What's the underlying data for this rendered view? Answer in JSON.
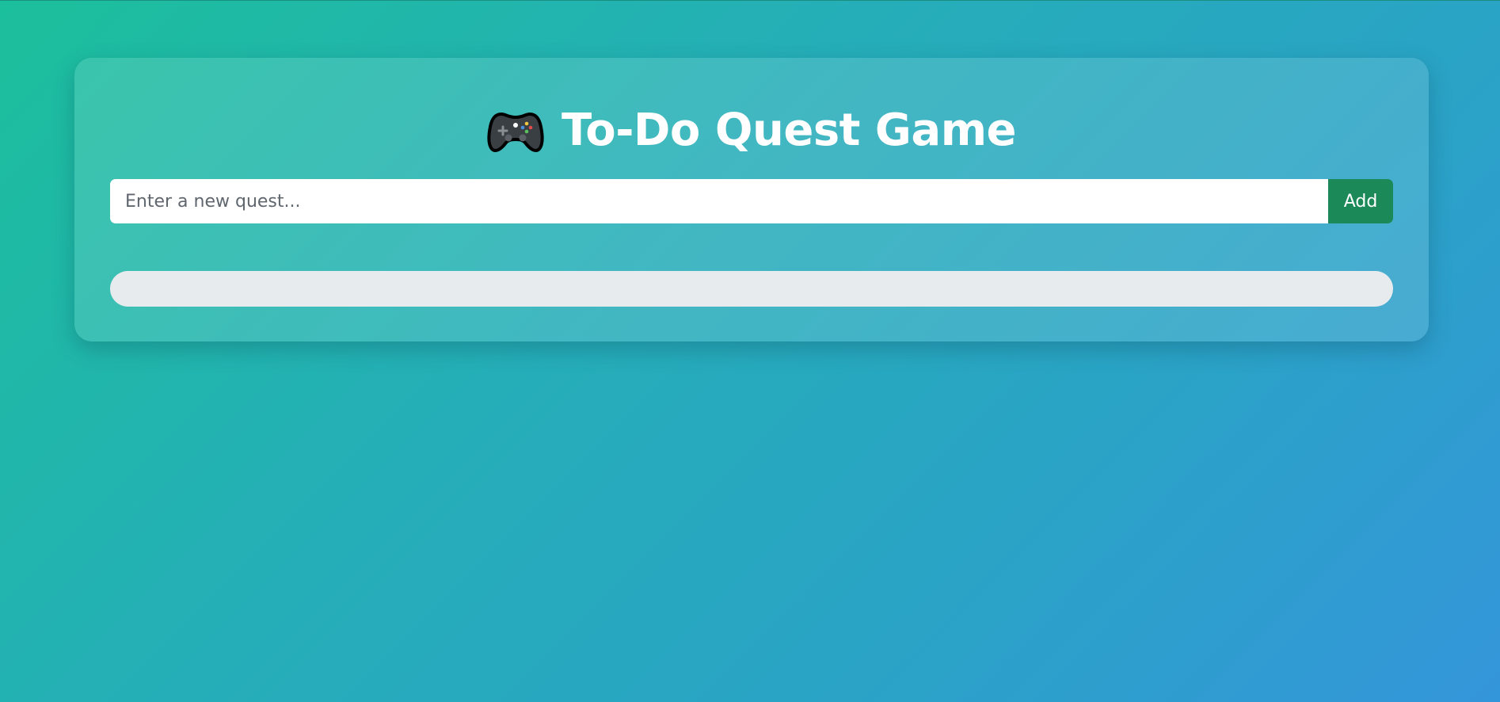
{
  "app": {
    "title": "To-Do Quest Game",
    "title_icon": "game-controller-icon"
  },
  "quest_form": {
    "input_value": "",
    "input_placeholder": "Enter a new quest...",
    "add_label": "Add"
  },
  "progress": {
    "fraction": 0
  },
  "colors": {
    "accent": "#1c8a58",
    "track": "#e8ebee"
  }
}
